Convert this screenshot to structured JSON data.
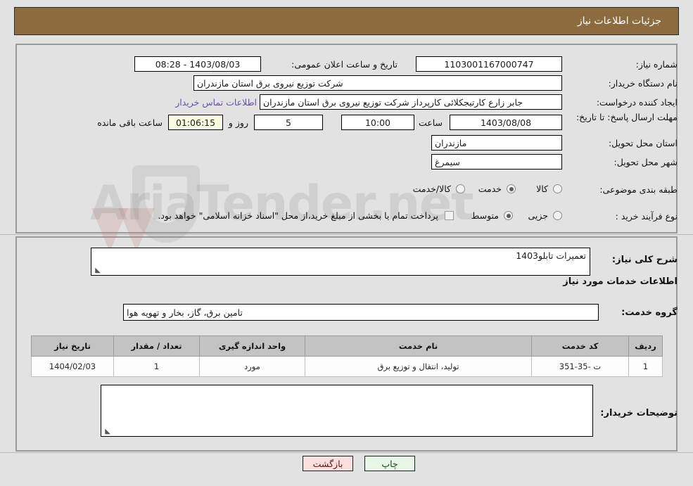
{
  "header": {
    "title": "جزئیات اطلاعات نیاز"
  },
  "top_form": {
    "need_number_label": "شماره نیاز:",
    "need_number_value": "1103001167000747",
    "public_announce_label": "تاریخ و ساعت اعلان عمومی:",
    "public_announce_value": "1403/08/03 - 08:28",
    "buyer_org_label": "نام دستگاه خریدار:",
    "buyer_org_value": "شرکت توزیع نیروی برق استان مازندران",
    "request_creator_label": "ایجاد کننده درخواست:",
    "request_creator_value": "جابر زارع کارتیجکلائی کارپرداز شرکت توزیع نیروی برق استان مازندران",
    "contact_link": "اطلاعات تماس خریدار",
    "deadline_label": "مهلت ارسال پاسخ: تا تاریخ:",
    "deadline_date": "1403/08/08",
    "hour_label": "ساعت",
    "hour_value": "10:00",
    "days_value": "5",
    "days_label": "روز و",
    "countdown_value": "01:06:15",
    "countdown_label": "ساعت باقی مانده",
    "province_label": "استان محل تحویل:",
    "province_value": "مازندران",
    "city_label": "شهر محل تحویل:",
    "city_value": "سیمرغ",
    "category_label": "طبقه بندی موضوعی:",
    "category_options": [
      "کالا",
      "خدمت",
      "کالا/خدمت"
    ],
    "category_selected": "خدمت",
    "process_label": "نوع فرآیند خرید :",
    "process_options": [
      "جزیی",
      "متوسط"
    ],
    "process_selected": "متوسط",
    "treasury_checkbox_text": "پرداخت تمام یا بخشی از مبلغ خرید،از محل \"اسناد خزانه اسلامی\" خواهد بود.",
    "treasury_checked": false
  },
  "mid_form": {
    "general_desc_label": "شرح کلی نیاز:",
    "general_desc_value": "تعمیرات تابلو1403",
    "services_info_heading": "اطلاعات خدمات مورد نیاز",
    "service_group_label": "گروه خدمت:",
    "service_group_value": "تامین برق، گاز، بخار و تهویه هوا",
    "buyer_notes_label": "توضیحات خریدار:",
    "buyer_notes_value": ""
  },
  "items_table": {
    "columns": [
      "ردیف",
      "کد خدمت",
      "نام خدمت",
      "واحد اندازه گیری",
      "تعداد / مقدار",
      "تاریخ نیاز"
    ],
    "rows": [
      {
        "row": "1",
        "service_code": "ت -35-351",
        "service_name": "تولید، انتقال و توزیع برق",
        "unit": "مورد",
        "quantity": "1",
        "need_date": "1404/02/03"
      }
    ]
  },
  "footer": {
    "print_label": "چاپ",
    "back_label": "بازگشت"
  },
  "watermark": {
    "text": "AriaTender.net"
  },
  "colors": {
    "header_brown": "#8c6b3f",
    "page_bg": "#e2e2e2",
    "link_purple": "#6b4fa8",
    "table_header": "#c3c3c3",
    "print_green": "#e8f6e8",
    "back_pink": "#fbdede",
    "countdown_yellow": "#fbfbe4"
  }
}
